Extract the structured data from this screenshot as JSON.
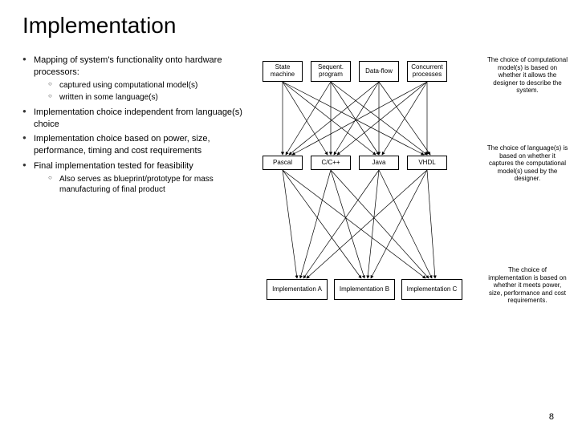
{
  "title": "Implementation",
  "bullets": [
    {
      "text": "Mapping of system's functionality onto hardware processors:",
      "sub": [
        "captured using computational model(s)",
        "written in some language(s)"
      ]
    },
    {
      "text": "Implementation choice independent from language(s) choice",
      "sub": []
    },
    {
      "text": "Implementation choice based on power, size, performance, timing and cost requirements",
      "sub": []
    },
    {
      "text": "Final implementation tested for feasibility",
      "sub": [
        "Also serves as blueprint/prototype for mass manufacturing of final product"
      ]
    }
  ],
  "diagram": {
    "row1": [
      "State machine",
      "Sequent. program",
      "Data-flow",
      "Concurrent processes"
    ],
    "row2": [
      "Pascal",
      "C/C++",
      "Java",
      "VHDL"
    ],
    "row3": [
      "Implementation A",
      "Implementation B",
      "Implementation C"
    ],
    "captions": [
      "The choice of computational model(s) is based on whether it allows the designer to describe the system.",
      "The choice of language(s) is based on whether it captures the computational model(s) used by the designer.",
      "The choice of implementation is based on whether it meets power, size, performance and cost requirements."
    ]
  },
  "page_number": "8"
}
